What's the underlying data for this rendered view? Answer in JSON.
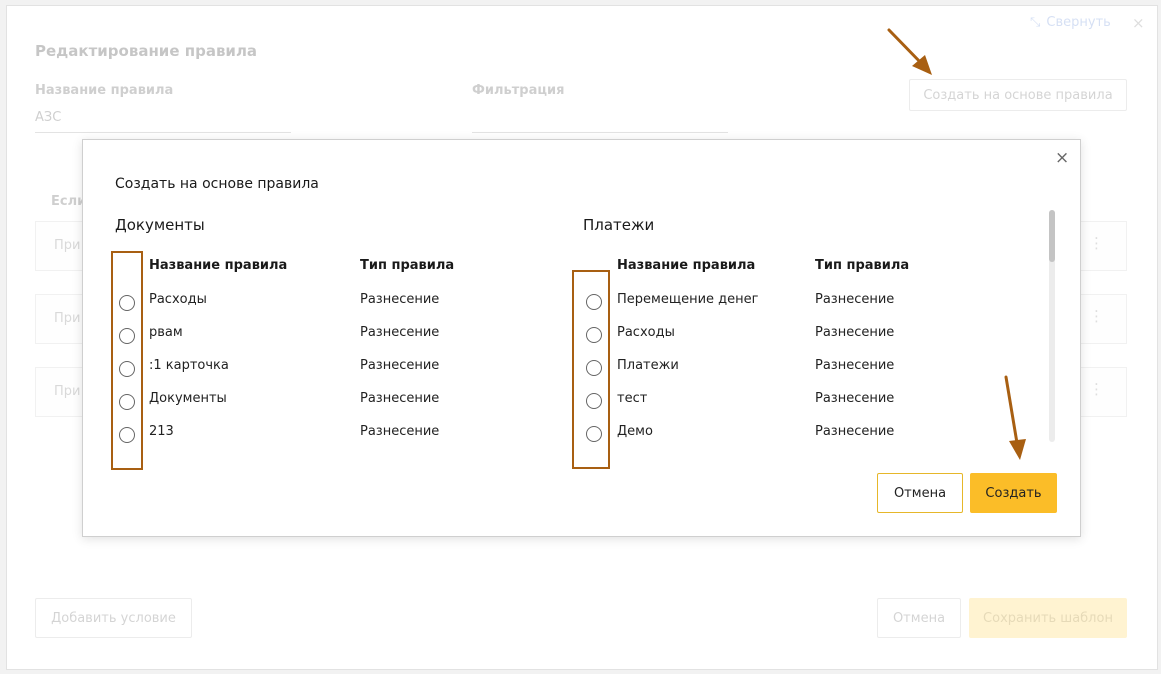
{
  "background": {
    "title": "Редактирование правила",
    "collapse_label": "Свернуть",
    "close_icon": "×",
    "rule_name_label": "Название правила",
    "rule_name_value": "АЗС",
    "filter_label": "Фильтрация",
    "create_from_rule_button": "Создать на основе правила",
    "condition_header": "Если",
    "rows": [
      {
        "text": "При"
      },
      {
        "text": "При"
      },
      {
        "text": "При"
      }
    ],
    "add_condition_button": "Добавить условие",
    "cancel_button": "Отмена",
    "save_template_button": "Сохранить шаблон"
  },
  "modal": {
    "title": "Создать на основе правила",
    "close_icon": "×",
    "documents": {
      "title": "Документы",
      "col_name": "Название правила",
      "col_type": "Тип правила",
      "rows": [
        {
          "name": "Расходы",
          "type": "Разнесение"
        },
        {
          "name": "рвам",
          "type": "Разнесение"
        },
        {
          "name": ":1 карточка",
          "type": "Разнесение"
        },
        {
          "name": "Документы",
          "type": "Разнесение"
        },
        {
          "name": "213",
          "type": "Разнесение"
        }
      ]
    },
    "payments": {
      "title": "Платежи",
      "col_name": "Название правила",
      "col_type": "Тип правила",
      "rows": [
        {
          "name": "Перемещение денег",
          "type": "Разнесение"
        },
        {
          "name": "Расходы",
          "type": "Разнесение"
        },
        {
          "name": "Платежи",
          "type": "Разнесение"
        },
        {
          "name": "тест",
          "type": "Разнесение"
        },
        {
          "name": "Демо",
          "type": "Разнесение"
        }
      ]
    },
    "cancel_button": "Отмена",
    "create_button": "Создать"
  },
  "colors": {
    "accent": "#fbbd28",
    "annotation": "#a85f12"
  }
}
